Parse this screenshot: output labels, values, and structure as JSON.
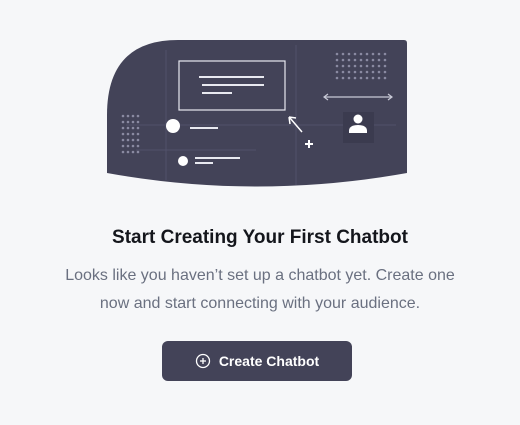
{
  "empty_state": {
    "title": "Start Creating Your First Chatbot",
    "description_line1": "Looks like you haven’t set up a chatbot yet. Create one",
    "description_line2": "now and start connecting with your audience.",
    "button_label": "Create Chatbot",
    "button_icon": "plus-circle-icon",
    "illustration": "chatbot-illustration"
  },
  "colors": {
    "background": "#f6f7f9",
    "illustration_fill": "#434358",
    "button_fill": "#434358",
    "title_text": "#14161c",
    "description_text": "#6a7080"
  }
}
